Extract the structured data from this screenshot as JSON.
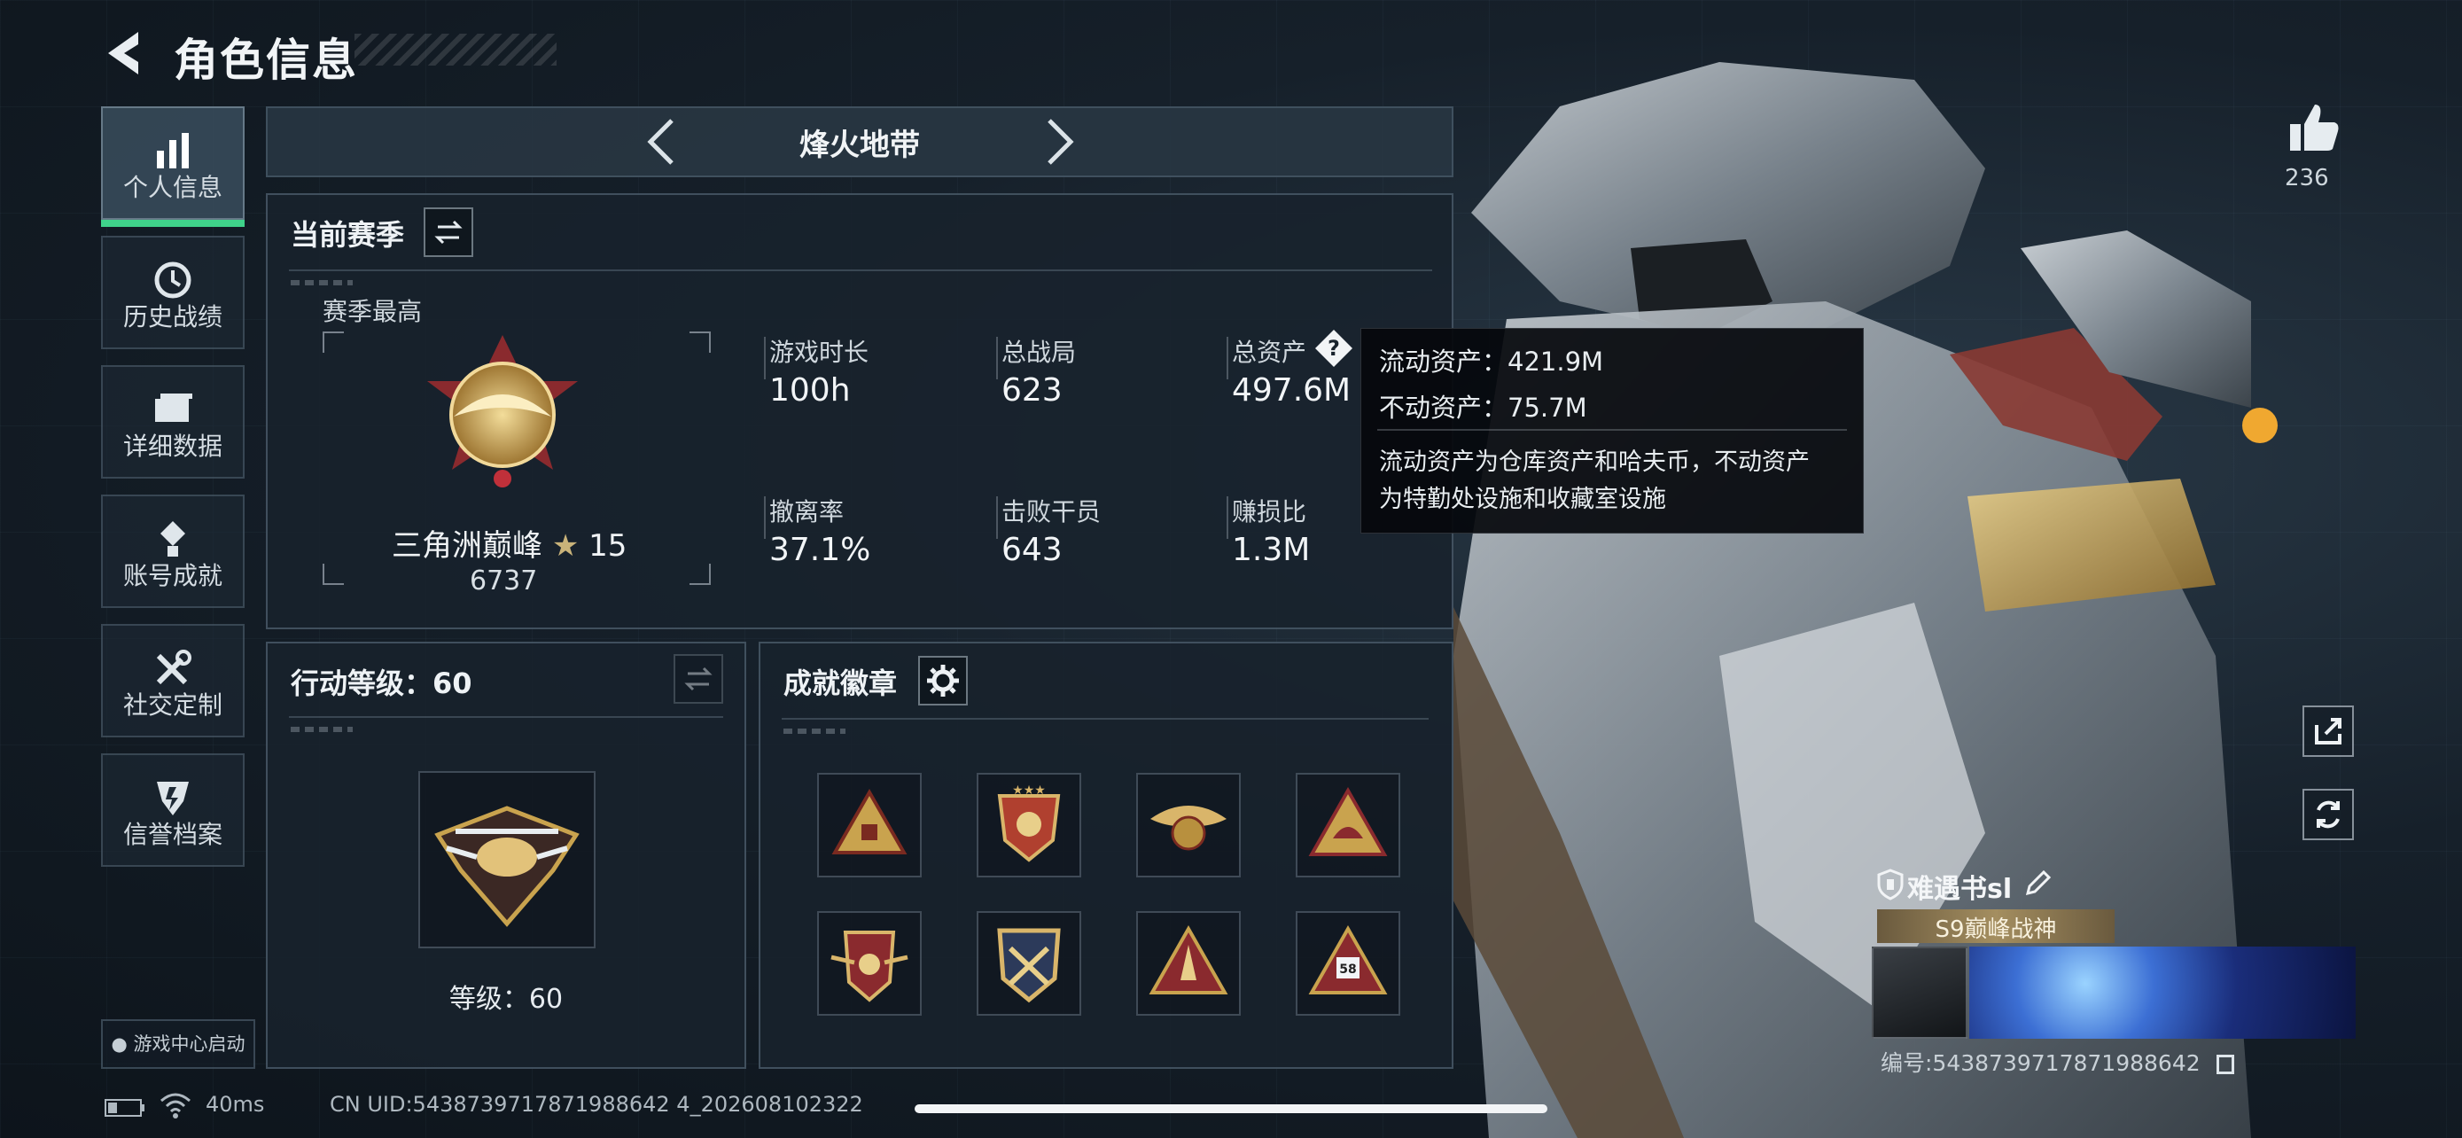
{
  "header": {
    "title": "角色信息"
  },
  "nav": {
    "items": [
      {
        "label": "个人信息",
        "icon": "bar-chart-icon",
        "active": true
      },
      {
        "label": "历史战绩",
        "icon": "history-clock-icon"
      },
      {
        "label": "详细数据",
        "icon": "folder-icon"
      },
      {
        "label": "账号成就",
        "icon": "medal-icon"
      },
      {
        "label": "社交定制",
        "icon": "tools-icon"
      },
      {
        "label": "信誉档案",
        "icon": "shield-badge-icon"
      }
    ],
    "game_center": "游戏中心启动"
  },
  "mode": {
    "label": "烽火地带"
  },
  "season": {
    "title": "当前赛季",
    "best_label": "赛季最高",
    "rank_name": "三角洲巅峰",
    "rank_stars": "15",
    "rank_points": "6737",
    "stats": [
      {
        "label": "游戏时长",
        "value": "100h"
      },
      {
        "label": "总战局",
        "value": "623"
      },
      {
        "label": "总资产",
        "value": "497.6M"
      },
      {
        "label": "撤离率",
        "value": "37.1%"
      },
      {
        "label": "击败干员",
        "value": "643"
      },
      {
        "label": "赚损比",
        "value": "1.3M"
      }
    ]
  },
  "tooltip": {
    "liquid": "流动资产：421.9M",
    "fixed": "不动资产：75.7M",
    "desc1": "流动资产为仓库资产和哈夫币，不动资产",
    "desc2": "为特勤处设施和收藏室设施"
  },
  "action_level": {
    "title": "行动等级：60",
    "level_text": "等级：60"
  },
  "badges": {
    "title": "成就徽章",
    "items": [
      "badge-triangle-gold",
      "badge-shield-stars",
      "badge-eagle-gold",
      "badge-triangle-helmet",
      "badge-shield-wings",
      "badge-shield-crossed",
      "badge-triangle-rocket",
      "badge-triangle-58"
    ]
  },
  "player": {
    "likes": "236",
    "name": "难遇书sl",
    "title": "S9巅峰战神",
    "id": "编号:5438739717871988642"
  },
  "status": {
    "ping": "40ms",
    "uid": "CN UID:5438739717871988642 4_202608102322"
  },
  "colors": {
    "accent_green": "#3fd28a",
    "gold": "#c9a34e",
    "panel": "#18222c"
  }
}
